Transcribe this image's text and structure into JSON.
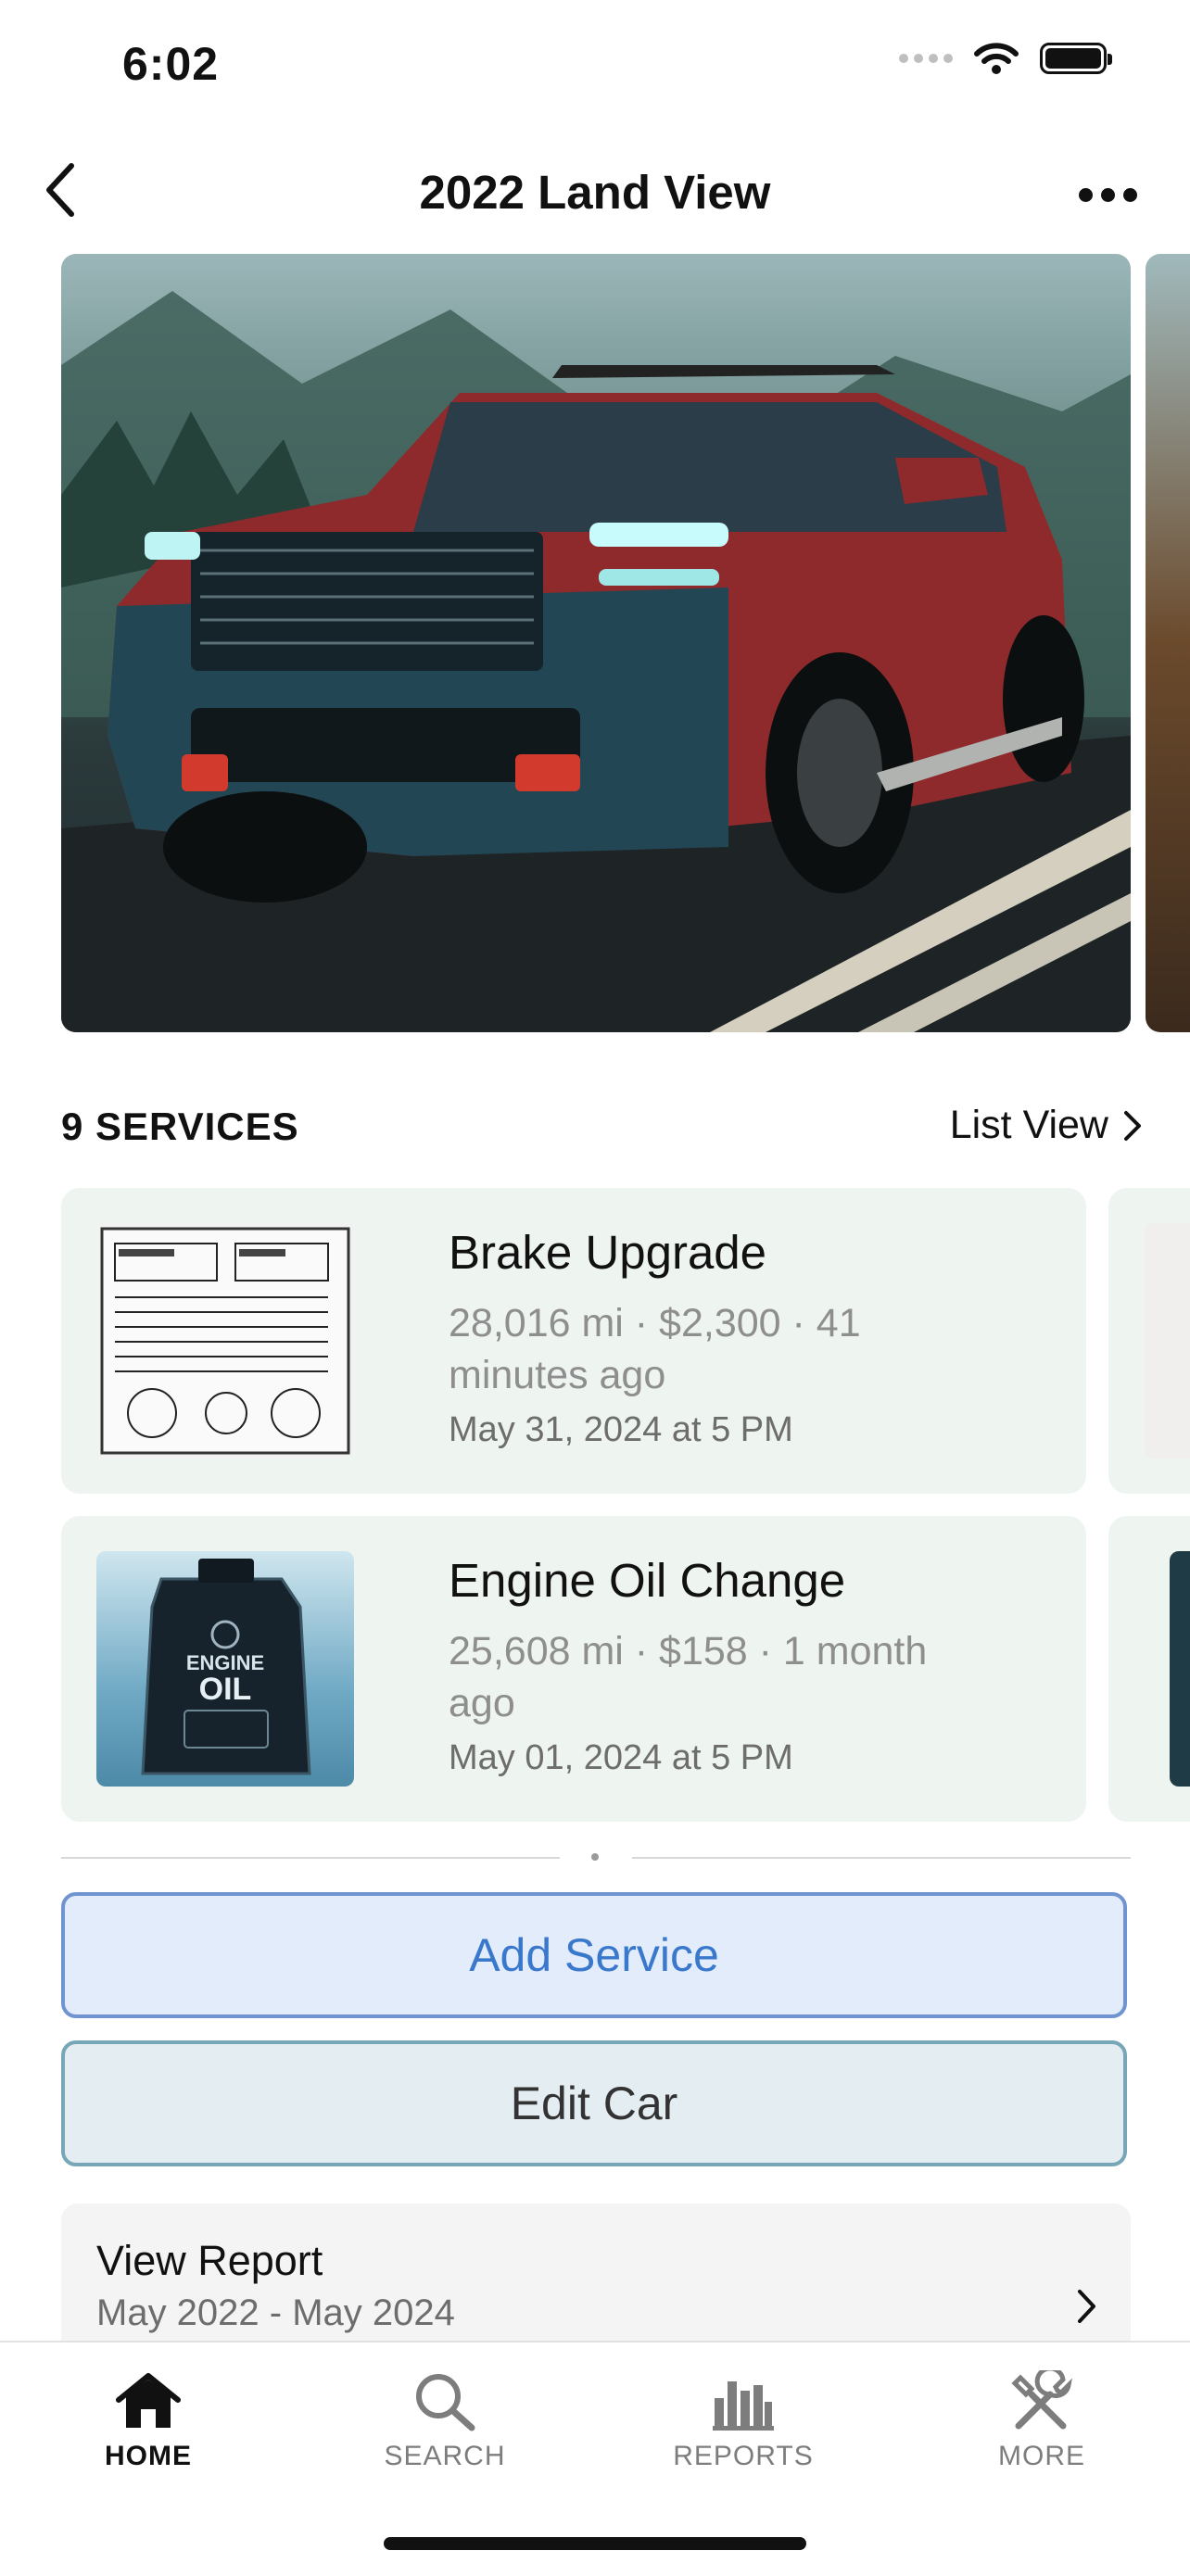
{
  "status_bar": {
    "time": "6:02"
  },
  "nav": {
    "title": "2022 Land View"
  },
  "services": {
    "count_label": "9 SERVICES",
    "list_view_label": "List View",
    "items": [
      {
        "title": "Brake Upgrade",
        "meta": "28,016 mi · $2,300 · 41 minutes ago",
        "date": "May 31, 2024 at 5 PM",
        "thumbnail": "service-invoice-sketch"
      },
      {
        "title": "Engine Oil Change",
        "meta": "25,608 mi · $158 · 1 month ago",
        "date": "May 01, 2024 at 5 PM",
        "thumbnail": "engine-oil-bottle",
        "thumb_text_top": "ENGINE",
        "thumb_text_big": "OIL"
      }
    ]
  },
  "actions": {
    "add_service": "Add Service",
    "edit_car": "Edit Car"
  },
  "report": {
    "title": "View Report",
    "range": "May 2022 - May 2024"
  },
  "tabs": [
    {
      "label": "HOME",
      "icon": "house-icon",
      "active": true
    },
    {
      "label": "SEARCH",
      "icon": "magnifier-icon",
      "active": false
    },
    {
      "label": "REPORTS",
      "icon": "bar-chart-icon",
      "active": false
    },
    {
      "label": "MORE",
      "icon": "tools-icon",
      "active": false
    }
  ],
  "colors": {
    "accent": "#3a78cc",
    "card_bg": "#eef4ef",
    "car_body": "#8e2a2c"
  }
}
